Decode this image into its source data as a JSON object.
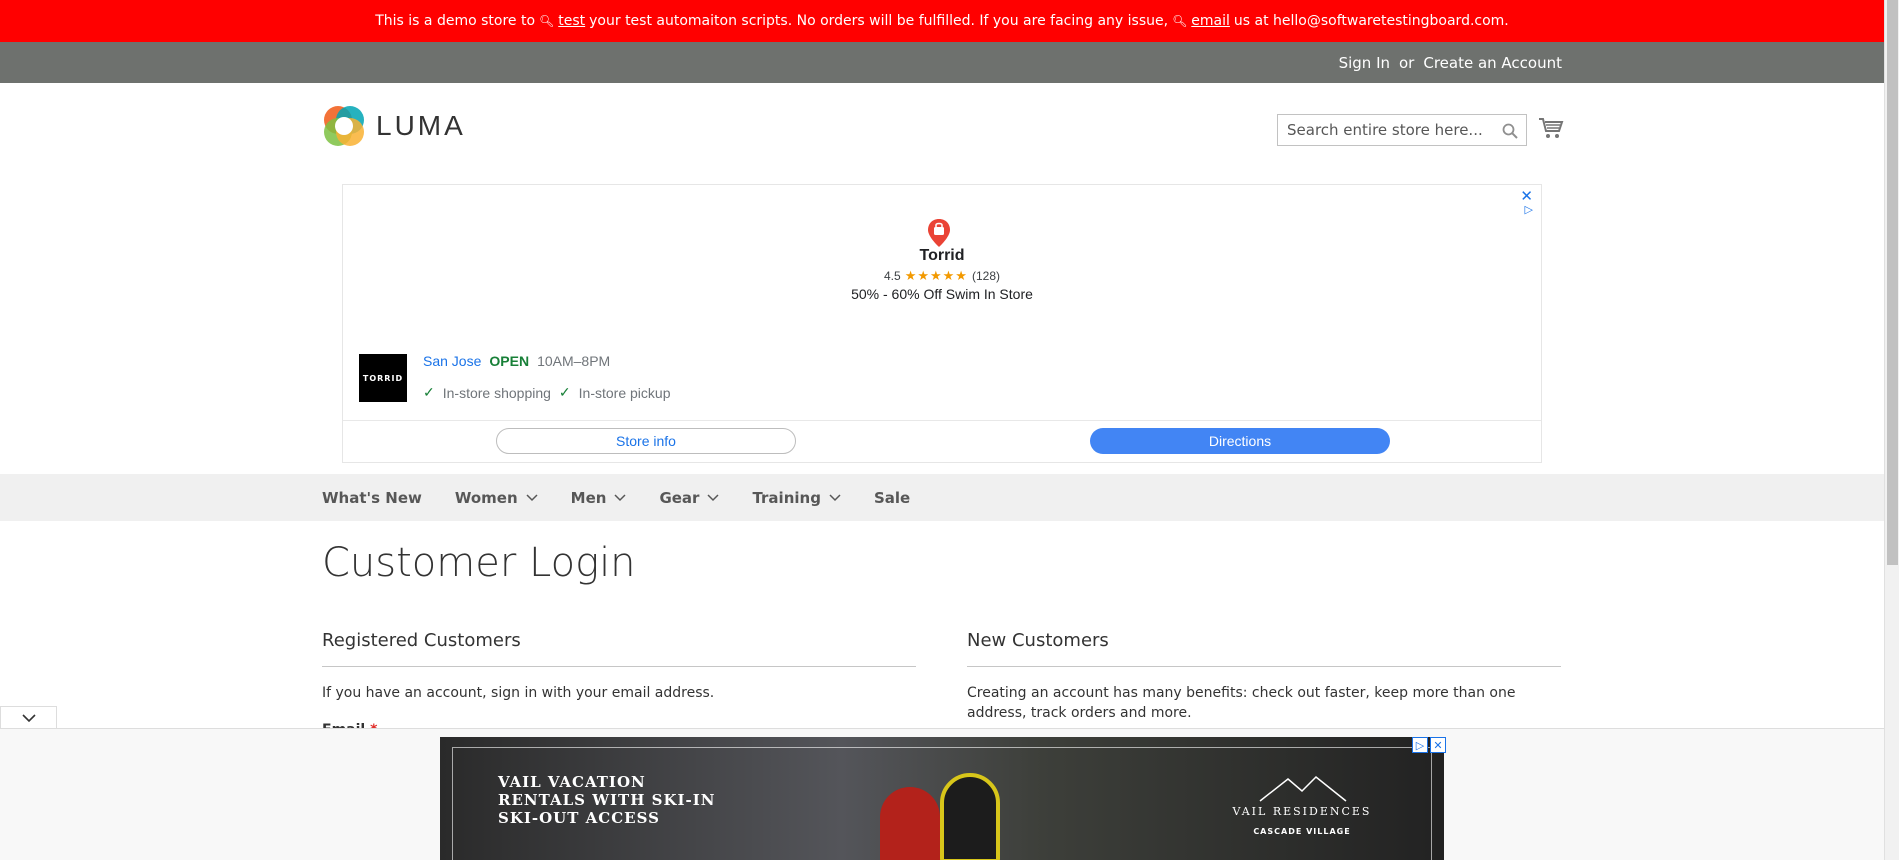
{
  "demo_banner": {
    "part1": "This is a demo store to",
    "link1": "test",
    "part2": "your test automaiton scripts. No orders will be fulfilled. If you are facing any issue,",
    "link2": "email",
    "part3": "us at hello@softwaretestingboard.com."
  },
  "header": {
    "sign_in": "Sign In",
    "or": "or",
    "create_account": "Create an Account"
  },
  "logo": {
    "text": "LUMA"
  },
  "search": {
    "placeholder": "Search entire store here..."
  },
  "ad": {
    "brand": "Torrid",
    "rating": "4.5",
    "stars": "★★★★★",
    "reviews": "(128)",
    "offer": "50% - 60% Off Swim In Store",
    "logo_text": "TORRID",
    "city": "San Jose",
    "status": "OPEN",
    "hours": "10AM–8PM",
    "feature1": "In-store shopping",
    "feature2": "In-store pickup",
    "store_info": "Store info",
    "directions": "Directions"
  },
  "nav": {
    "items": [
      {
        "label": "What's New"
      },
      {
        "label": "Women"
      },
      {
        "label": "Men"
      },
      {
        "label": "Gear"
      },
      {
        "label": "Training"
      },
      {
        "label": "Sale"
      }
    ]
  },
  "main": {
    "title": "Customer Login",
    "registered_title": "Registered Customers",
    "registered_text": "If you have an account, sign in with your email address.",
    "email_label": "Email",
    "email_required": "*",
    "new_title": "New Customers",
    "new_text": "Creating an account has many benefits: check out faster, keep more than one address, track orders and more."
  },
  "bottom_ad": {
    "headline_line1": "VAIL VACATION",
    "headline_line2": "RENTALS WITH SKI-IN",
    "headline_line3": "SKI-OUT ACCESS",
    "brand": "VAIL RESIDENCES",
    "brand_sub": "CASCADE VILLAGE"
  },
  "colors": {
    "banner": "#ff0000",
    "header_panel": "#6e716e",
    "nav_bg": "#f0f0f0",
    "ad_link": "#1a73e8",
    "open_green": "#188038"
  }
}
